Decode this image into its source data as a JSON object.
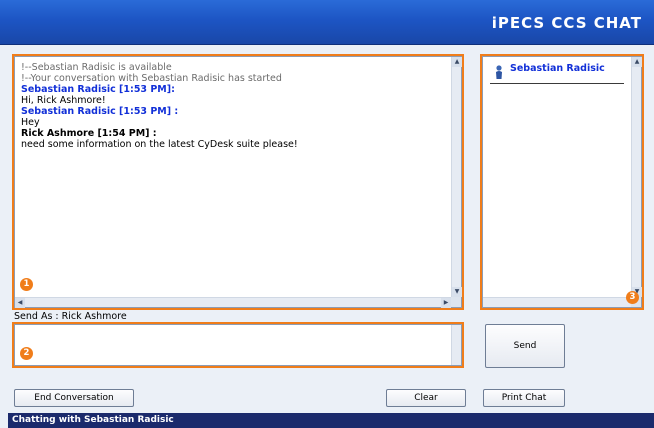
{
  "header": {
    "title": "iPECS CCS CHAT"
  },
  "conversation": {
    "lines": [
      {
        "text": "!--Sebastian Radisic is available",
        "style": "sys"
      },
      {
        "text": "!--Your conversation with Sebastian Radisic has started",
        "style": "sys"
      },
      {
        "text": "Sebastian Radisic [1:53 PM]:",
        "style": "blue"
      },
      {
        "text": "Hi, Rick Ashmore!",
        "style": "normal"
      },
      {
        "text": "Sebastian Radisic [1:53 PM] :",
        "style": "blue"
      },
      {
        "text": "Hey",
        "style": "normal"
      },
      {
        "text": "Rick Ashmore [1:54 PM] :",
        "style": "bold"
      },
      {
        "text": "need some information on the latest CyDesk suite please!",
        "style": "normal"
      }
    ]
  },
  "participants": {
    "items": [
      {
        "name": "Sebastian Radisic"
      }
    ]
  },
  "compose": {
    "send_as": "Send As : Rick Ashmore",
    "value": ""
  },
  "buttons": {
    "send": "Send",
    "end_conversation": "End Conversation",
    "clear": "Clear",
    "print_chat": "Print Chat"
  },
  "badges": {
    "conversation": "1",
    "compose": "2",
    "participants": "3"
  },
  "status": {
    "text": "Chatting with Sebastian Radisic"
  },
  "colors": {
    "header": "#1d55c4",
    "highlight": "#f07d1a",
    "sender": "#1230d8",
    "status_bar": "#1b2a6c"
  }
}
